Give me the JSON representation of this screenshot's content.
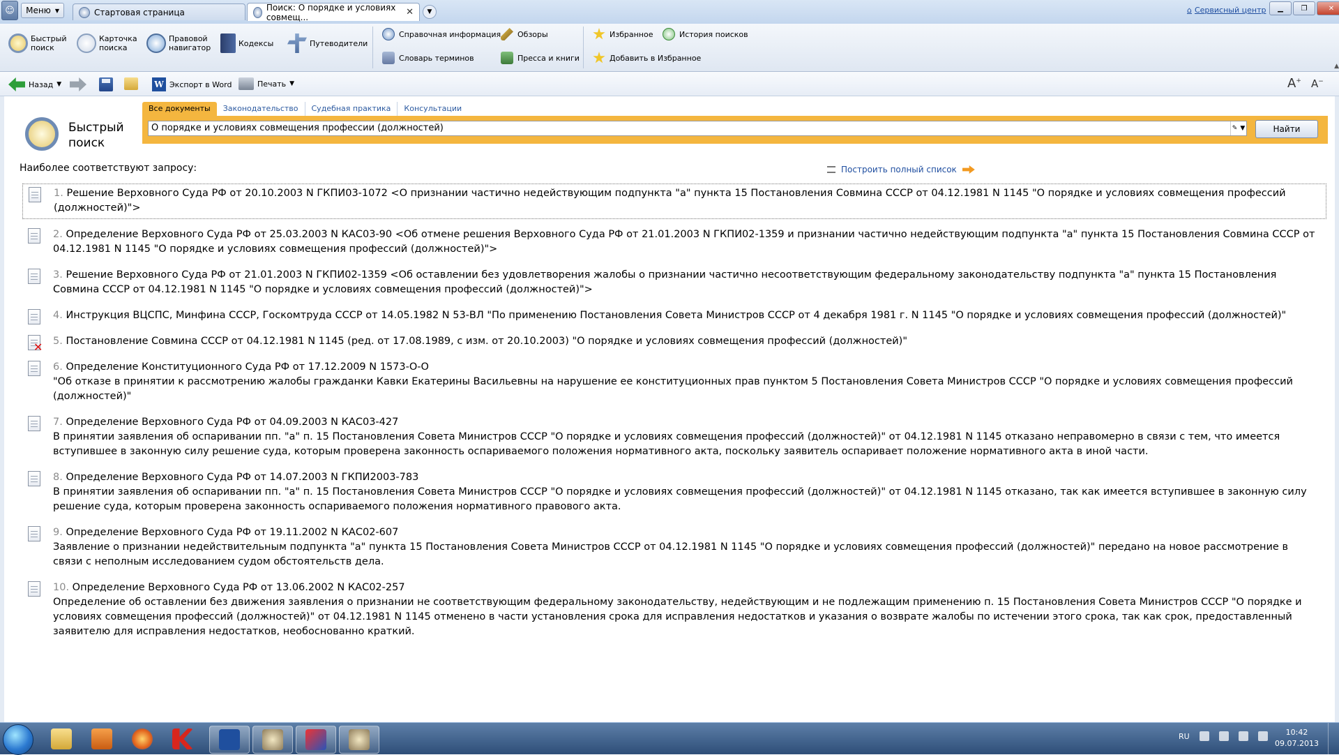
{
  "tabbar": {
    "menu_label": "Меню",
    "tabs": [
      {
        "label": "Стартовая страница"
      },
      {
        "label": "Поиск: О порядке и условиях совмещ..."
      }
    ],
    "service_center": "Сервисный центр"
  },
  "ribbon": {
    "big_buttons": [
      {
        "label_line1": "Быстрый",
        "label_line2": "поиск",
        "icon": "magnifier-icon"
      },
      {
        "label_line1": "Карточка",
        "label_line2": "поиска",
        "icon": "search-card-icon"
      },
      {
        "label_line1": "Правовой",
        "label_line2": "навигатор",
        "icon": "compass-icon"
      },
      {
        "label_line1": "Кодексы",
        "label_line2": "",
        "icon": "codex-book-icon"
      },
      {
        "label_line1": "Путеводители",
        "label_line2": "",
        "icon": "signpost-icon"
      }
    ],
    "small_buttons": {
      "reference": "Справочная информация",
      "reviews": "Обзоры",
      "dictionary": "Словарь терминов",
      "press": "Пресса и книги",
      "favorites": "Избранное",
      "history": "История поисков",
      "add_favorite": "Добавить в Избранное"
    }
  },
  "toolbar": {
    "back": "Назад",
    "export_word": "Экспорт в Word",
    "print": "Печать",
    "font_larger": "A",
    "font_smaller": "A"
  },
  "search": {
    "title_line1": "Быстрый",
    "title_line2": "поиск",
    "tabs": [
      "Все документы",
      "Законодательство",
      "Судебная практика",
      "Консультации"
    ],
    "query": "О порядке и условиях совмещения профессии (должностей)",
    "button": "Найти"
  },
  "results": {
    "heading": "Наиболее соответствуют запросу:",
    "full_list": "Построить полный список",
    "items": [
      {
        "num": "1.",
        "text": "Решение Верховного Суда РФ от 20.10.2003 N ГКПИ03-1072 <О признании частично недействующим подпункта \"а\" пункта 15 Постановления Совмина СССР от 04.12.1981 N 1145 \"О порядке и условиях совмещения профессий (должностей)\">",
        "desc": ""
      },
      {
        "num": "2.",
        "text": "Определение Верховного Суда РФ от 25.03.2003 N КАС03-90 <Об отмене решения Верховного Суда РФ от 21.01.2003 N ГКПИ02-1359 и признании частично недействующим подпункта \"а\" пункта 15 Постановления Совмина СССР от 04.12.1981 N 1145 \"О порядке и условиях совмещения профессий (должностей)\">",
        "desc": ""
      },
      {
        "num": "3.",
        "text": "Решение Верховного Суда РФ от 21.01.2003 N ГКПИ02-1359 <Об оставлении без удовлетворения жалобы о признании частично несоответствующим федеральному законодательству подпункта \"а\" пункта 15 Постановления Совмина СССР от 04.12.1981 N 1145 \"О порядке и условиях совмещения профессий (должностей)\">",
        "desc": ""
      },
      {
        "num": "4.",
        "text": "Инструкция ВЦСПС, Минфина СССР, Госкомтруда СССР от 14.05.1982 N 53-ВЛ \"По применению Постановления Совета Министров СССР от 4 декабря 1981 г. N 1145 \"О порядке и условиях совмещения профессий (должностей)\"",
        "desc": ""
      },
      {
        "num": "5.",
        "text": "Постановление Совмина СССР от 04.12.1981 N 1145 (ред. от 17.08.1989, с изм. от 20.10.2003) \"О порядке и условиях совмещения профессий (должностей)\"",
        "desc": ""
      },
      {
        "num": "6.",
        "text": "Определение Конституционного Суда РФ от 17.12.2009 N 1573-О-О",
        "desc": "\"Об отказе в принятии к рассмотрению жалобы гражданки Кавки Екатерины Васильевны на нарушение ее конституционных прав пунктом 5 Постановления Совета Министров СССР \"О порядке и условиях совмещения профессий (должностей)\""
      },
      {
        "num": "7.",
        "text": "Определение Верховного Суда РФ от 04.09.2003 N КАС03-427",
        "desc": "В принятии заявления об оспаривании пп. \"а\" п. 15 Постановления Совета Министров СССР \"О порядке и условиях совмещения профессий (должностей)\" от 04.12.1981 N 1145 отказано неправомерно в связи с тем, что имеется вступившее в законную силу решение суда, которым проверена законность оспариваемого положения нормативного акта, поскольку заявитель оспаривает положение нормативного акта в иной части."
      },
      {
        "num": "8.",
        "text": "Определение Верховного Суда РФ от 14.07.2003 N ГКПИ2003-783",
        "desc": "В принятии заявления об оспаривании пп. \"а\" п. 15 Постановления Совета Министров СССР \"О порядке и условиях совмещения профессий (должностей)\" от 04.12.1981 N 1145 отказано, так как имеется вступившее в законную силу решение суда, которым проверена законность оспариваемого положения нормативного правового акта."
      },
      {
        "num": "9.",
        "text": "Определение Верховного Суда РФ от 19.11.2002 N КАС02-607",
        "desc": "Заявление о признании недействительным подпункта \"а\" пункта 15 Постановления Совета Министров СССР от 04.12.1981 N 1145 \"О порядке и условиях совмещения профессий (должностей)\" передано на новое рассмотрение в связи с неполным исследованием судом обстоятельств дела."
      },
      {
        "num": "10.",
        "text": "Определение Верховного Суда РФ от 13.06.2002 N КАС02-257",
        "desc": "Определение об оставлении без движения заявления о признании не соответствующим федеральному законодательству, недействующим и не подлежащим применению п. 15 Постановления Совета Министров СССР \"О порядке и условиях совмещения профессий (должностей)\" от 04.12.1981 N 1145 отменено в части установления срока для исправления недостатков и указания о возврате жалобы по истечении этого срока, так как срок, предоставленный заявителю для исправления недостатков, необоснованно краткий."
      }
    ]
  },
  "taskbar": {
    "lang": "RU",
    "time": "10:42",
    "date": "09.07.2013",
    "apps": [
      "folder-icon",
      "media-player-icon",
      "firefox-icon",
      "kaspersky-icon",
      "word-icon",
      "consultant-icon",
      "mail-icon",
      "consultant-icon"
    ]
  },
  "colors": {
    "search_band": "#f4b63f",
    "link": "#1f4ea0",
    "invalid_mark": "#e01010"
  }
}
